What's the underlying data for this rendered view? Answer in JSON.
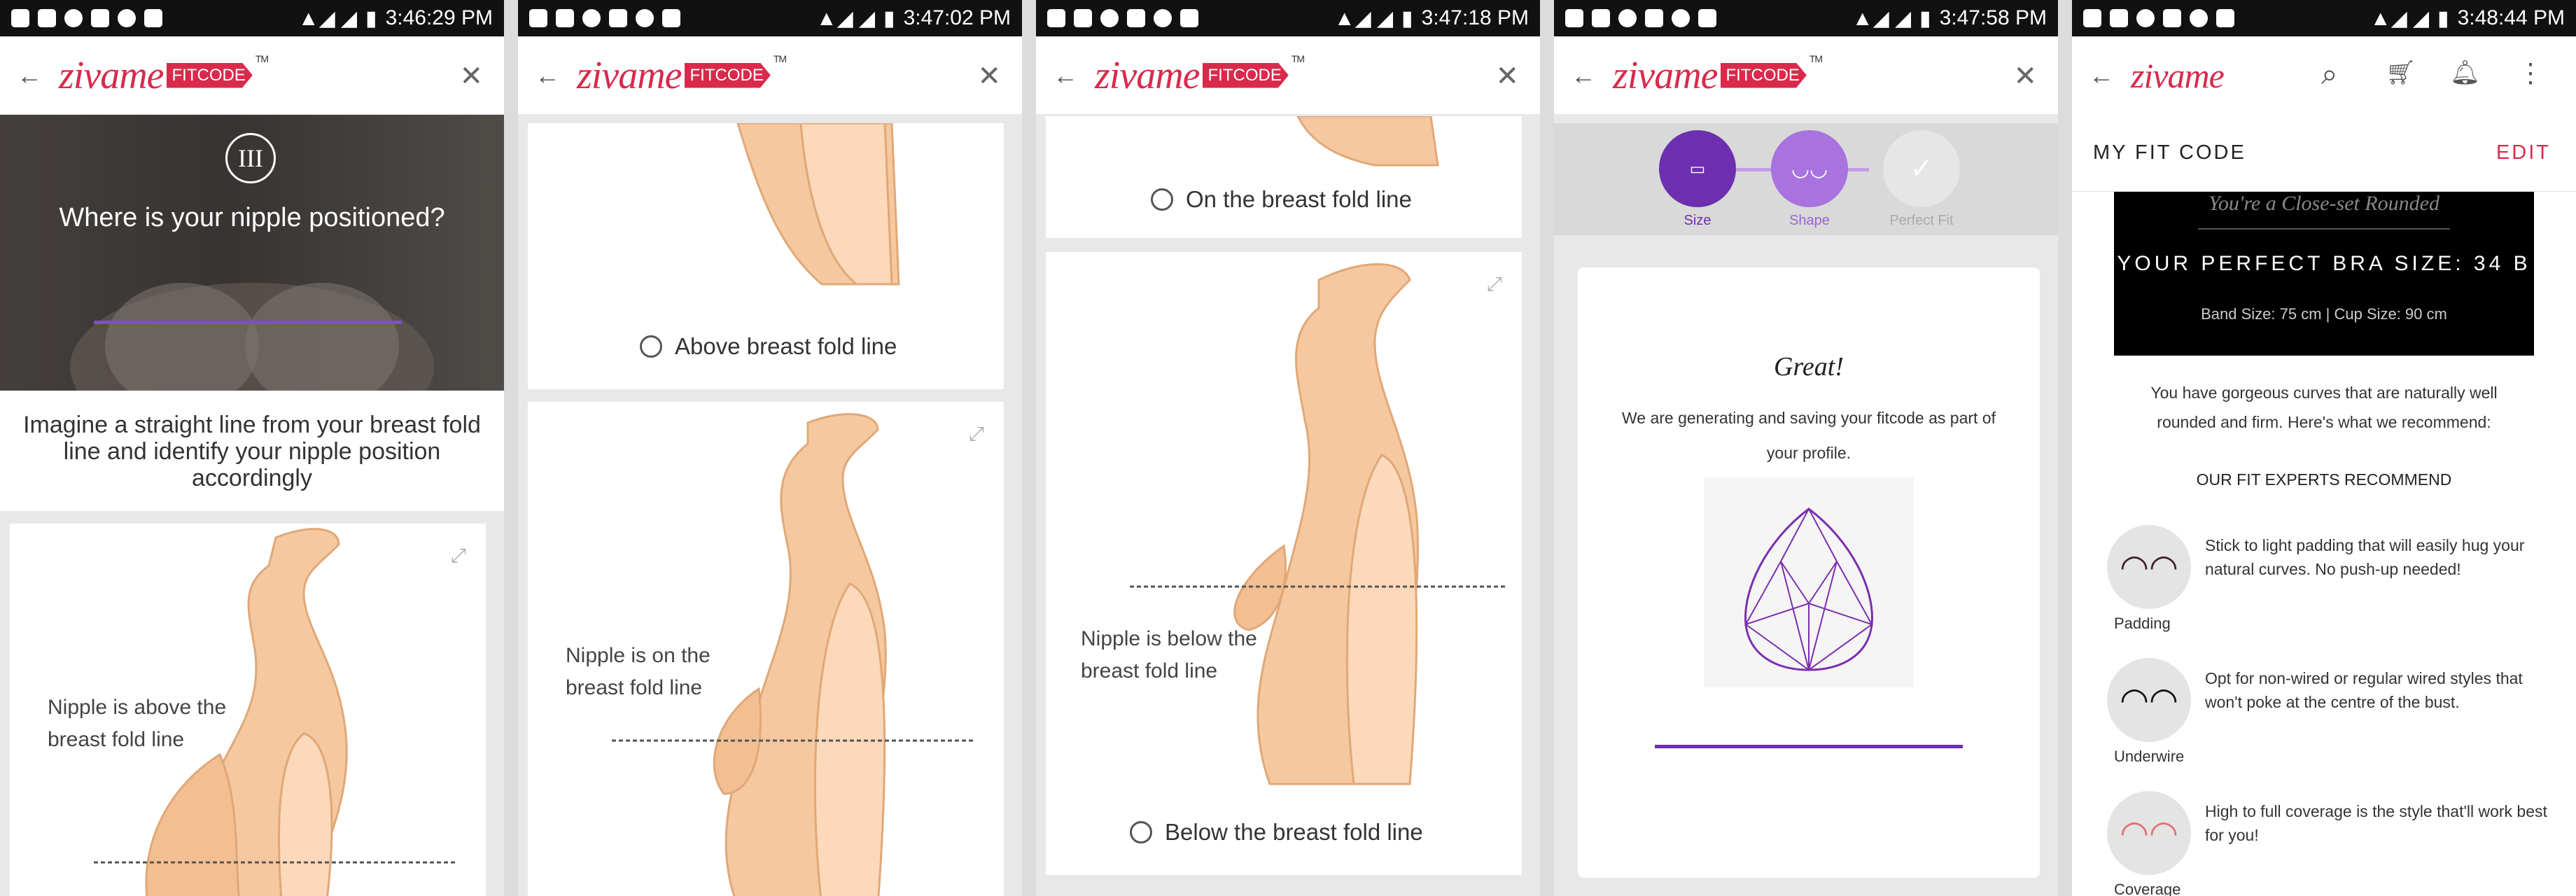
{
  "status_times": [
    "3:46:29 PM",
    "3:47:02 PM",
    "3:47:18 PM",
    "3:47:58 PM",
    "3:48:44 PM"
  ],
  "brand": {
    "name": "zivame",
    "fitcode": "FITCODE",
    "tm": "TM",
    "color": "#d92a4c"
  },
  "screen1": {
    "step": "III",
    "question": "Where is your nipple positioned?",
    "instruction": "Imagine a straight line from your breast fold line and identify your nipple position accordingly",
    "diagram_label": "Nipple is above the breast fold line"
  },
  "screen2": {
    "option1": "Above breast fold line",
    "diagram_label": "Nipple is on the breast fold line"
  },
  "screen3": {
    "option1": "On the breast fold line",
    "diagram_label": "Nipple is below the breast fold line",
    "option2": "Below the breast fold line"
  },
  "screen4": {
    "steps": [
      "Size",
      "Shape",
      "Perfect Fit"
    ],
    "title": "Great!",
    "message": "We are generating and saving your fitcode as part of your profile.",
    "accent": "#6d2fb0"
  },
  "screen5": {
    "header_title": "MY FIT CODE",
    "edit": "EDIT",
    "hero_subtitle": "You're a Close-set Rounded",
    "bra_size": "YOUR PERFECT BRA SIZE: 34 B",
    "band_cup": "Band Size: 75 cm | Cup Size: 90 cm",
    "description": "You have gorgeous curves that are naturally well rounded and firm. Here's what we recommend:",
    "recommend_title": "OUR FIT EXPERTS RECOMMEND",
    "recommendations": [
      {
        "label": "Padding",
        "text": "Stick to light padding that will easily hug your natural curves. No push-up needed!"
      },
      {
        "label": "Underwire",
        "text": "Opt for non-wired or regular wired styles that won't poke at the centre of the bust."
      },
      {
        "label": "Coverage",
        "text": "High to full coverage is the style that'll work best for you!"
      }
    ]
  }
}
